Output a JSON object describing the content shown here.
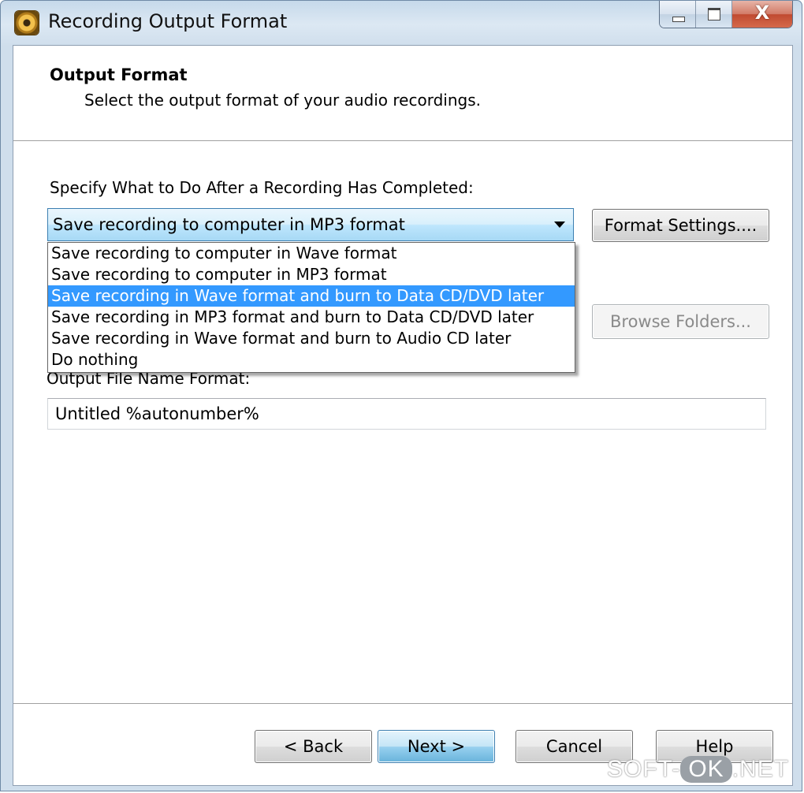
{
  "window": {
    "title": "Recording Output Format",
    "close_glyph": "X"
  },
  "header": {
    "title": "Output Format",
    "subtitle": "Select the output format of your audio recordings."
  },
  "main": {
    "specify_label": "Specify What to Do After a Recording Has Completed:",
    "combo_value": "Save recording to computer in MP3 format",
    "format_settings_button": "Format Settings....",
    "browse_folders_button": "Browse Folders...",
    "output_name_label": "Output File Name Format:",
    "output_name_value": "Untitled %autonumber%",
    "dropdown_options": [
      "Save recording to computer in Wave format",
      "Save recording to computer in MP3 format",
      "Save recording in Wave format and burn to Data CD/DVD later",
      "Save recording in MP3 format and burn to Data CD/DVD later",
      "Save recording in Wave format and burn to Audio CD later",
      "Do nothing"
    ],
    "highlighted_option": "Save recording in Wave format and burn to Data CD/DVD later"
  },
  "footer": {
    "back": "< Back",
    "next": "Next >",
    "cancel": "Cancel",
    "help": "Help"
  },
  "watermark": {
    "prefix": "SOFT-",
    "badge": "OK",
    "suffix": ".NET"
  },
  "colors": {
    "selection": "#3399ff",
    "combo_border": "#3c7fb1"
  },
  "icons": [
    "app-speaker-icon",
    "minimize-icon",
    "maximize-icon",
    "close-icon",
    "chevron-down-icon"
  ]
}
